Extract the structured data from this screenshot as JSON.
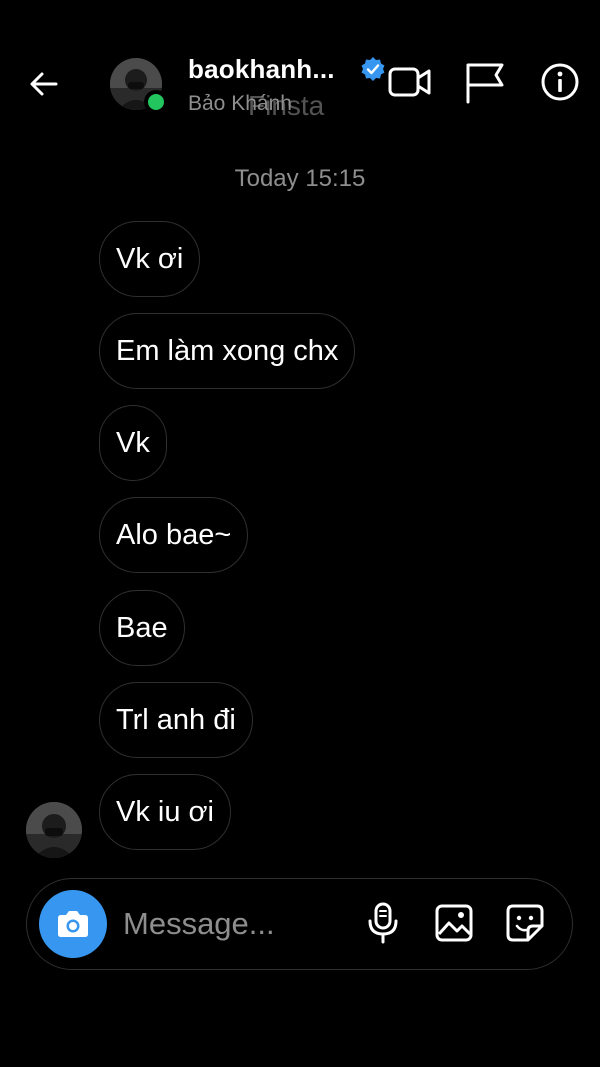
{
  "header": {
    "username": "baokhanh...",
    "subtitle": "Bảo Khánh",
    "ghost_text": "Finsta",
    "online_color": "#22c55e",
    "verified_color": "#3797f0",
    "icons": [
      "back-arrow-icon",
      "video-camera-icon",
      "flag-icon",
      "info-icon"
    ]
  },
  "thread": {
    "timestamp": "Today 15:15",
    "messages": [
      {
        "text": "Vk ơi"
      },
      {
        "text": "Em làm xong chx"
      },
      {
        "text": "Vk"
      },
      {
        "text": "Alo bae~"
      },
      {
        "text": "Bae"
      },
      {
        "text": "Trl anh đi"
      },
      {
        "text": "Vk iu ơi"
      }
    ]
  },
  "composer": {
    "placeholder": "Message...",
    "camera_color": "#3797f0",
    "icons": [
      "camera-icon",
      "microphone-icon",
      "gallery-icon",
      "sticker-icon"
    ]
  }
}
